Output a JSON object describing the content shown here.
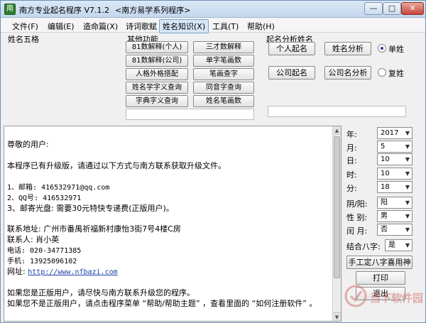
{
  "window": {
    "title": "南方专业起名程序 V7.1.2",
    "subtitle": "<南方易学系列程序>",
    "min": "—",
    "max": "□",
    "close": "✕"
  },
  "menu": [
    "文件(F)",
    "编辑(E)",
    "造命篇(X)",
    "诗词歌赋",
    "姓名知识(X)",
    "工具(T)",
    "帮助(H)"
  ],
  "groups": {
    "wuge": "姓名五格",
    "other": "其他功能",
    "analysis": "起名分析姓名"
  },
  "other_buttons": [
    "81数解释(个人)",
    "三才数解释",
    "81数解释(公司)",
    "单字笔画数",
    "人格外格搭配",
    "笔画查字",
    "姓名学字义查询",
    "同音字查询",
    "字典字义查询",
    "姓名笔画数"
  ],
  "analysis_buttons": [
    "个人起名",
    "姓名分析",
    "公司起名",
    "公司名分析"
  ],
  "radios": [
    {
      "label": "单姓",
      "checked": true
    },
    {
      "label": "复姓",
      "checked": false
    }
  ],
  "text_lines": {
    "l1": "尊敬的用户:",
    "l2": "本程序已有升级版，请通过以下方式与南方联系获取升级文件。",
    "l3": "1、邮箱: 416532971@qq.com",
    "l4": "2、QQ号: 416532971",
    "l5": "3、邮寄光盘: 需要30元特快专递费(正版用户)。",
    "l6": "联系地址: 广州市番禺祈福新村康怡3街7号4楼C房",
    "l7": "联系人: 肖小英",
    "l8": "电话: 020-34771385",
    "l9": "手机: 13925096102",
    "l10_label": "网址: ",
    "l10_link": "http://www.nfbazi.com",
    "l11": "如果您是正版用户，请尽快与南方联系升级您的程序。",
    "l12": "如果您不是正版用户，请点击程序菜单 “帮助/帮助主题” ，查看里面的 “如何注册软件” 。"
  },
  "date_fields": [
    {
      "label": "年:",
      "value": "2017"
    },
    {
      "label": "月:",
      "value": "5"
    },
    {
      "label": "日:",
      "value": "10"
    },
    {
      "label": "时:",
      "value": "10"
    },
    {
      "label": "分:",
      "value": "18"
    }
  ],
  "option_fields": [
    {
      "label": "阴/阳:",
      "value": "阳"
    },
    {
      "label": "性  别:",
      "value": "男"
    },
    {
      "label": "闰  月:",
      "value": "否"
    }
  ],
  "bazi": {
    "label": "结合八字:",
    "value": "是"
  },
  "right_buttons": {
    "manual": "手工定八字喜用神",
    "print": "打印",
    "exit": "退出"
  },
  "watermark": "当下软件园",
  "accent_color": "#1a3fa8"
}
